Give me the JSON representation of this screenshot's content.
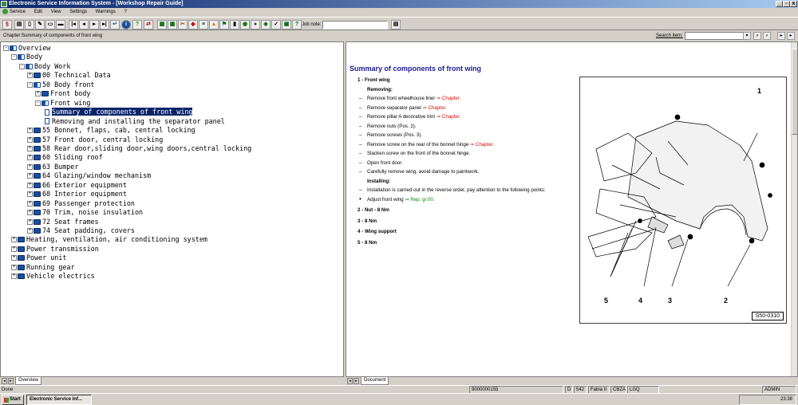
{
  "window": {
    "title": "Electronic Service Information System - [Workshop Repair Guide]",
    "controls": [
      "_",
      "▫",
      "x"
    ]
  },
  "menu": [
    "Service",
    "Edit",
    "View",
    "Settings",
    "Warnings",
    "?"
  ],
  "toolbar": {
    "job_note_label": "Job note:",
    "job_note_value": ""
  },
  "pathbar": {
    "path": "Chapter:Summary of components of front wing",
    "search_label": "Search item:",
    "search_value": ""
  },
  "tree": [
    {
      "depth": 0,
      "exp": "-",
      "icon": "book-open",
      "label": "Overview"
    },
    {
      "depth": 1,
      "exp": "-",
      "icon": "book-open",
      "label": "Body"
    },
    {
      "depth": 2,
      "exp": "-",
      "icon": "book-open",
      "label": "Body Work"
    },
    {
      "depth": 3,
      "exp": "+",
      "icon": "book",
      "label": "00 Technical Data"
    },
    {
      "depth": 3,
      "exp": "-",
      "icon": "book-open",
      "label": "50 Body front"
    },
    {
      "depth": 4,
      "exp": "+",
      "icon": "book",
      "label": "Front body"
    },
    {
      "depth": 4,
      "exp": "-",
      "icon": "book-open",
      "label": "Front wing"
    },
    {
      "depth": 5,
      "exp": "",
      "icon": "page",
      "label": "Summary of components of front wing",
      "selected": true
    },
    {
      "depth": 5,
      "exp": "",
      "icon": "page",
      "label": "Removing and installing the separator panel"
    },
    {
      "depth": 3,
      "exp": "+",
      "icon": "book",
      "label": "55 Bonnet, flaps, cab, central locking"
    },
    {
      "depth": 3,
      "exp": "+",
      "icon": "book",
      "label": "57 Front door, central locking"
    },
    {
      "depth": 3,
      "exp": "+",
      "icon": "book",
      "label": "58 Rear door,sliding door,wing doors,central locking"
    },
    {
      "depth": 3,
      "exp": "+",
      "icon": "book",
      "label": "60 Sliding roof"
    },
    {
      "depth": 3,
      "exp": "+",
      "icon": "book",
      "label": "63 Bumper"
    },
    {
      "depth": 3,
      "exp": "+",
      "icon": "book",
      "label": "64 Glazing/window mechanism"
    },
    {
      "depth": 3,
      "exp": "+",
      "icon": "book",
      "label": "66 Exterior equipment"
    },
    {
      "depth": 3,
      "exp": "+",
      "icon": "book",
      "label": "68 Interior equipment"
    },
    {
      "depth": 3,
      "exp": "+",
      "icon": "book",
      "label": "69 Passenger protection"
    },
    {
      "depth": 3,
      "exp": "+",
      "icon": "book",
      "label": "70 Trim, noise insulation"
    },
    {
      "depth": 3,
      "exp": "+",
      "icon": "book",
      "label": "72 Seat frames"
    },
    {
      "depth": 3,
      "exp": "+",
      "icon": "book",
      "label": "74 Seat padding, covers"
    },
    {
      "depth": 1,
      "exp": "+",
      "icon": "book",
      "label": "Heating, ventilation, air conditioning system"
    },
    {
      "depth": 1,
      "exp": "+",
      "icon": "book",
      "label": "Power transmission"
    },
    {
      "depth": 1,
      "exp": "+",
      "icon": "book",
      "label": "Power unit"
    },
    {
      "depth": 1,
      "exp": "+",
      "icon": "book",
      "label": "Running gear"
    },
    {
      "depth": 1,
      "exp": "+",
      "icon": "book",
      "label": "Vehicle electrics"
    }
  ],
  "tabs": {
    "left": "Overview",
    "right": "Document"
  },
  "document": {
    "title": "Summary of components of front wing",
    "item1": "1 - Front wing",
    "removing": "Removing:",
    "steps_removing": [
      {
        "text": "Remove front wheelhouse liner ",
        "link": "⇒ Chapter."
      },
      {
        "text": "Remove separator panel ",
        "link": "⇒ Chapter."
      },
      {
        "text": "Remove pillar A decorative trim ",
        "link": "⇒ Chapter."
      },
      {
        "text": "Remove nuts (Pos. 2).",
        "link": ""
      },
      {
        "text": "Remove screws (Pos. 3).",
        "link": ""
      },
      {
        "text": "Remove screw on the rear of the bonnet hinge ",
        "link": "⇒ Chapter."
      },
      {
        "text": "Slacken screw on the front of the bonnet hinge.",
        "link": ""
      },
      {
        "text": "Open front door.",
        "link": ""
      },
      {
        "text": "Carefully remove wing, avoid damage to paintwork.",
        "link": ""
      }
    ],
    "installing": "Installing:",
    "install_step": "Installation is carried out in the reverse order, pay attention to the following points:",
    "adjust_text": "Adjust front wing ",
    "adjust_link": "⇒ Rep. gr.00.",
    "items": [
      "2 - Nut - 8 Nm",
      "3 - 8 Nm",
      "4 - Wing support",
      "5 - 8 Nm"
    ],
    "figure_code": "S50-0310",
    "figure_labels": [
      "1",
      "5",
      "4",
      "3",
      "2"
    ]
  },
  "status": {
    "text": "Done",
    "number": "9000000155",
    "lang": "D",
    "code": "542",
    "model": "Fabia II",
    "engine": "CBZA",
    "gear": "LGQ",
    "user": "ADMIN"
  },
  "taskbar": {
    "start": "Start",
    "task": "Electronic Service Inf...",
    "time": "23:38"
  }
}
